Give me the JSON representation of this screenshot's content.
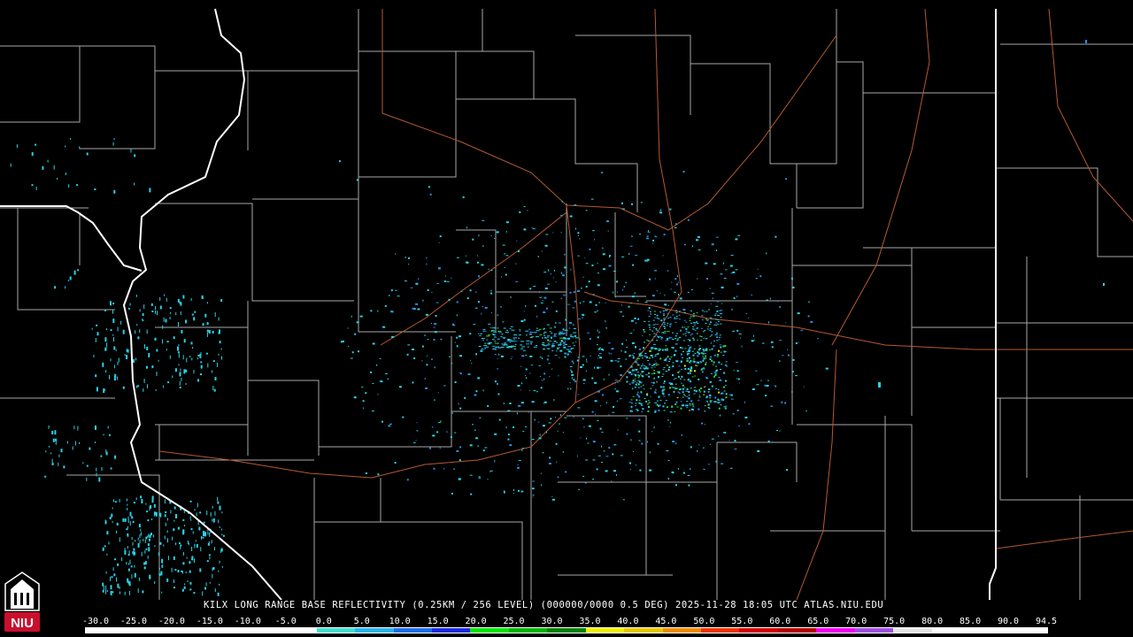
{
  "caption": "KILX LONG RANGE BASE REFLECTIVITY (0.25KM / 256 LEVEL) (000000/0000 0.5 DEG) 2025-11-28 18:05 UTC  ATLAS.NIU.EDU",
  "logo": {
    "text": "NIU",
    "color": "#c8102e"
  },
  "colorbar": {
    "ticks": [
      "-30.0",
      "-25.0",
      "-20.0",
      "-15.0",
      "-10.0",
      "-5.0",
      "0.0",
      "5.0",
      "10.0",
      "15.0",
      "20.0",
      "25.0",
      "30.0",
      "35.0",
      "40.0",
      "45.0",
      "50.0",
      "55.0",
      "60.0",
      "65.0",
      "70.0",
      "75.0",
      "80.0",
      "85.0",
      "90.0",
      "94.5"
    ],
    "colors": [
      "#ffffff",
      "#ffffff",
      "#ffffff",
      "#ffffff",
      "#ffffff",
      "#ffffff",
      "#40e0d0",
      "#2ab4e8",
      "#1e6ee6",
      "#1e2adc",
      "#00e600",
      "#00b400",
      "#008200",
      "#f0f000",
      "#e6c800",
      "#f08c00",
      "#f03200",
      "#d20000",
      "#b40000",
      "#f000f0",
      "#a050e0",
      "#e6e6e6",
      "#ffffff",
      "#ffffff",
      "#ffffff"
    ]
  },
  "map_colors": {
    "background": "#000000",
    "county_lines": "#a8a8a8",
    "state_lines": "#ffffff",
    "roads": "#b45a32",
    "echo_light": "#2ad2e6",
    "echo_mid": "#2a8ce6",
    "echo_green": "#36d236",
    "echo_yellow": "#e6e600"
  }
}
